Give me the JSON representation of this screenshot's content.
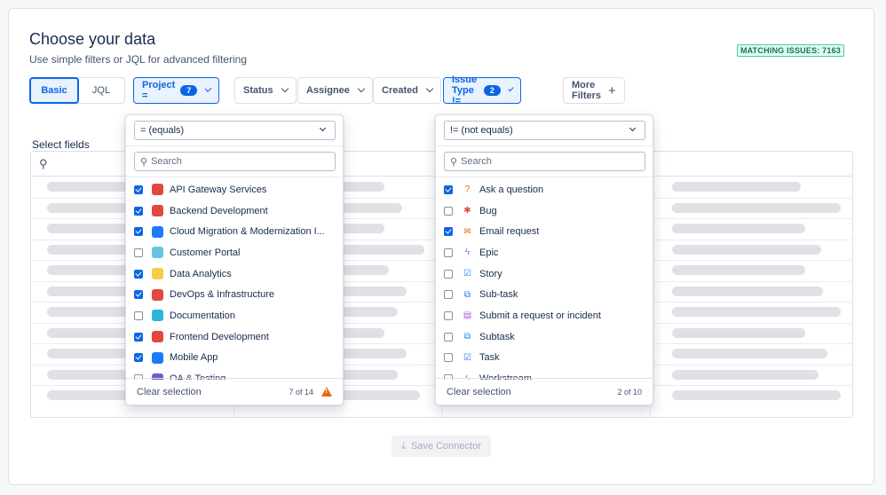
{
  "header": {
    "title": "Choose your data",
    "subtitle": "Use simple filters or JQL for advanced filtering",
    "matching": "MATCHING ISSUES: 7163"
  },
  "mode_toggle": {
    "basic": "Basic",
    "jql": "JQL",
    "selected": "Basic"
  },
  "filters": {
    "project": {
      "label": "Project =",
      "count": "7"
    },
    "status": "Status",
    "assignee": "Assignee",
    "created": "Created",
    "issue_type": {
      "label": "Issue Type !=",
      "count": "2"
    },
    "more": "More Filters"
  },
  "select_fields": {
    "label": "Select fields"
  },
  "save_button": "Save Connector",
  "project_dropdown": {
    "operator": "= (equals)",
    "search_placeholder": "Search",
    "items": [
      {
        "label": "API Gateway Services",
        "checked": true,
        "color": "#e2483d"
      },
      {
        "label": "Backend Development",
        "checked": true,
        "color": "#e2483d"
      },
      {
        "label": "Cloud Migration & Modernization I...",
        "checked": true,
        "color": "#1d7afc"
      },
      {
        "label": "Customer Portal",
        "checked": false,
        "color": "#6cc3e0"
      },
      {
        "label": "Data Analytics",
        "checked": true,
        "color": "#f5cd47"
      },
      {
        "label": "DevOps & Infrastructure",
        "checked": true,
        "color": "#e2483d"
      },
      {
        "label": "Documentation",
        "checked": false,
        "color": "#2ab4d6"
      },
      {
        "label": "Frontend Development",
        "checked": true,
        "color": "#e2483d"
      },
      {
        "label": "Mobile App",
        "checked": true,
        "color": "#1d7afc"
      },
      {
        "label": "QA & Testing",
        "checked": false,
        "color": "#6e5dc6"
      }
    ],
    "clear": "Clear selection",
    "count": "7 of 14"
  },
  "issue_type_dropdown": {
    "operator": "!= (not equals)",
    "search_placeholder": "Search",
    "items": [
      {
        "label": "Ask a question",
        "checked": true,
        "icon": "question-icon",
        "glyph": "?",
        "color": "#e56910"
      },
      {
        "label": "Bug",
        "checked": false,
        "icon": "bug-icon",
        "glyph": "✱",
        "color": "#e2483d"
      },
      {
        "label": "Email request",
        "checked": true,
        "icon": "email-icon",
        "glyph": "✉",
        "color": "#e56910"
      },
      {
        "label": "Epic",
        "checked": false,
        "icon": "epic-icon",
        "glyph": "ϟ",
        "color": "#af59e1"
      },
      {
        "label": "Story",
        "checked": false,
        "icon": "story-icon",
        "glyph": "☑",
        "color": "#1d7afc"
      },
      {
        "label": "Sub-task",
        "checked": false,
        "icon": "subtask-icon",
        "glyph": "⧉",
        "color": "#1d7afc"
      },
      {
        "label": "Submit a request or incident",
        "checked": false,
        "icon": "request-icon",
        "glyph": "▤",
        "color": "#af59e1"
      },
      {
        "label": "Subtask",
        "checked": false,
        "icon": "subtask-icon",
        "glyph": "⧉",
        "color": "#1d7afc"
      },
      {
        "label": "Task",
        "checked": false,
        "icon": "task-icon",
        "glyph": "☑",
        "color": "#1d7afc"
      },
      {
        "label": "Workstream",
        "checked": false,
        "icon": "workstream-icon",
        "glyph": "ϟ",
        "color": "#af59e1"
      }
    ],
    "clear": "Clear selection",
    "count": "2 of 10"
  }
}
